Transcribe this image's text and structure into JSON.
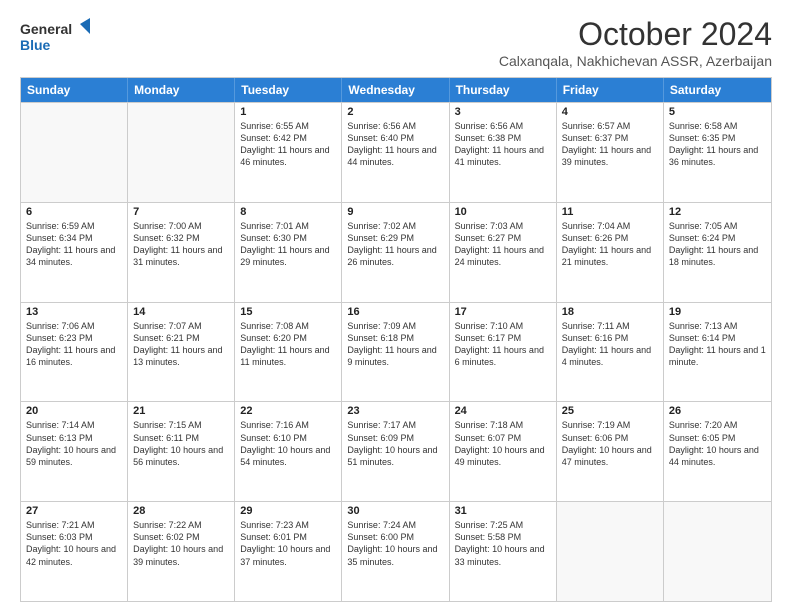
{
  "logo": {
    "line1": "General",
    "line2": "Blue"
  },
  "title": "October 2024",
  "subtitle": "Calxanqala, Nakhichevan ASSR, Azerbaijan",
  "days": [
    "Sunday",
    "Monday",
    "Tuesday",
    "Wednesday",
    "Thursday",
    "Friday",
    "Saturday"
  ],
  "rows": [
    [
      {
        "day": "",
        "empty": true
      },
      {
        "day": "",
        "empty": true
      },
      {
        "day": "1",
        "sunrise": "6:55 AM",
        "sunset": "6:42 PM",
        "daylight": "11 hours and 46 minutes."
      },
      {
        "day": "2",
        "sunrise": "6:56 AM",
        "sunset": "6:40 PM",
        "daylight": "11 hours and 44 minutes."
      },
      {
        "day": "3",
        "sunrise": "6:56 AM",
        "sunset": "6:38 PM",
        "daylight": "11 hours and 41 minutes."
      },
      {
        "day": "4",
        "sunrise": "6:57 AM",
        "sunset": "6:37 PM",
        "daylight": "11 hours and 39 minutes."
      },
      {
        "day": "5",
        "sunrise": "6:58 AM",
        "sunset": "6:35 PM",
        "daylight": "11 hours and 36 minutes."
      }
    ],
    [
      {
        "day": "6",
        "sunrise": "6:59 AM",
        "sunset": "6:34 PM",
        "daylight": "11 hours and 34 minutes."
      },
      {
        "day": "7",
        "sunrise": "7:00 AM",
        "sunset": "6:32 PM",
        "daylight": "11 hours and 31 minutes."
      },
      {
        "day": "8",
        "sunrise": "7:01 AM",
        "sunset": "6:30 PM",
        "daylight": "11 hours and 29 minutes."
      },
      {
        "day": "9",
        "sunrise": "7:02 AM",
        "sunset": "6:29 PM",
        "daylight": "11 hours and 26 minutes."
      },
      {
        "day": "10",
        "sunrise": "7:03 AM",
        "sunset": "6:27 PM",
        "daylight": "11 hours and 24 minutes."
      },
      {
        "day": "11",
        "sunrise": "7:04 AM",
        "sunset": "6:26 PM",
        "daylight": "11 hours and 21 minutes."
      },
      {
        "day": "12",
        "sunrise": "7:05 AM",
        "sunset": "6:24 PM",
        "daylight": "11 hours and 18 minutes."
      }
    ],
    [
      {
        "day": "13",
        "sunrise": "7:06 AM",
        "sunset": "6:23 PM",
        "daylight": "11 hours and 16 minutes."
      },
      {
        "day": "14",
        "sunrise": "7:07 AM",
        "sunset": "6:21 PM",
        "daylight": "11 hours and 13 minutes."
      },
      {
        "day": "15",
        "sunrise": "7:08 AM",
        "sunset": "6:20 PM",
        "daylight": "11 hours and 11 minutes."
      },
      {
        "day": "16",
        "sunrise": "7:09 AM",
        "sunset": "6:18 PM",
        "daylight": "11 hours and 9 minutes."
      },
      {
        "day": "17",
        "sunrise": "7:10 AM",
        "sunset": "6:17 PM",
        "daylight": "11 hours and 6 minutes."
      },
      {
        "day": "18",
        "sunrise": "7:11 AM",
        "sunset": "6:16 PM",
        "daylight": "11 hours and 4 minutes."
      },
      {
        "day": "19",
        "sunrise": "7:13 AM",
        "sunset": "6:14 PM",
        "daylight": "11 hours and 1 minute."
      }
    ],
    [
      {
        "day": "20",
        "sunrise": "7:14 AM",
        "sunset": "6:13 PM",
        "daylight": "10 hours and 59 minutes."
      },
      {
        "day": "21",
        "sunrise": "7:15 AM",
        "sunset": "6:11 PM",
        "daylight": "10 hours and 56 minutes."
      },
      {
        "day": "22",
        "sunrise": "7:16 AM",
        "sunset": "6:10 PM",
        "daylight": "10 hours and 54 minutes."
      },
      {
        "day": "23",
        "sunrise": "7:17 AM",
        "sunset": "6:09 PM",
        "daylight": "10 hours and 51 minutes."
      },
      {
        "day": "24",
        "sunrise": "7:18 AM",
        "sunset": "6:07 PM",
        "daylight": "10 hours and 49 minutes."
      },
      {
        "day": "25",
        "sunrise": "7:19 AM",
        "sunset": "6:06 PM",
        "daylight": "10 hours and 47 minutes."
      },
      {
        "day": "26",
        "sunrise": "7:20 AM",
        "sunset": "6:05 PM",
        "daylight": "10 hours and 44 minutes."
      }
    ],
    [
      {
        "day": "27",
        "sunrise": "7:21 AM",
        "sunset": "6:03 PM",
        "daylight": "10 hours and 42 minutes."
      },
      {
        "day": "28",
        "sunrise": "7:22 AM",
        "sunset": "6:02 PM",
        "daylight": "10 hours and 39 minutes."
      },
      {
        "day": "29",
        "sunrise": "7:23 AM",
        "sunset": "6:01 PM",
        "daylight": "10 hours and 37 minutes."
      },
      {
        "day": "30",
        "sunrise": "7:24 AM",
        "sunset": "6:00 PM",
        "daylight": "10 hours and 35 minutes."
      },
      {
        "day": "31",
        "sunrise": "7:25 AM",
        "sunset": "5:58 PM",
        "daylight": "10 hours and 33 minutes."
      },
      {
        "day": "",
        "empty": true
      },
      {
        "day": "",
        "empty": true
      }
    ]
  ]
}
